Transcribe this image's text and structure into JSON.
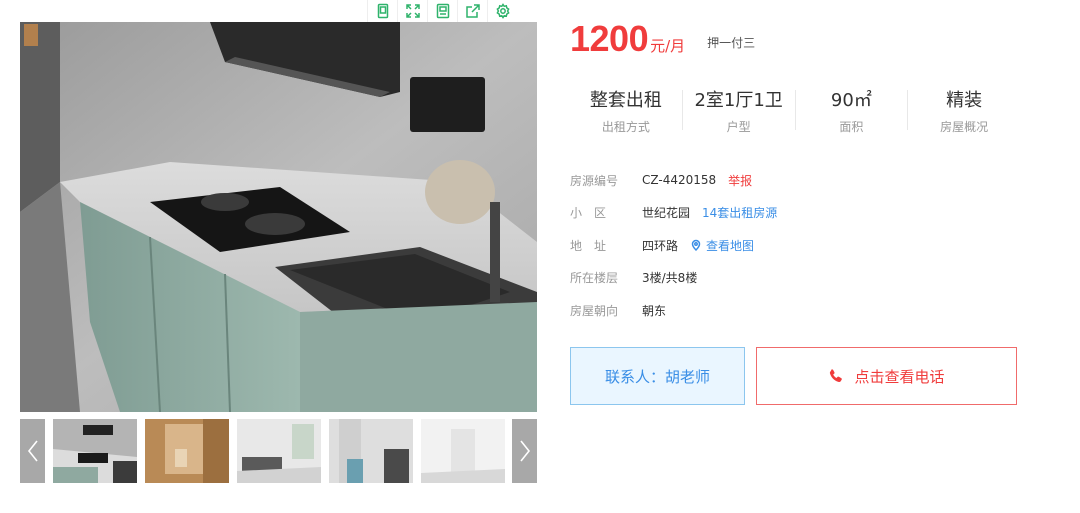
{
  "toolbar": {
    "icons": [
      "tablet-icon",
      "fullscreen-icon",
      "save-icon",
      "share-icon",
      "settings-icon"
    ]
  },
  "gallery": {
    "prev_icon": "chevron-left-icon",
    "next_icon": "chevron-right-icon",
    "thumbnails": [
      "kitchen",
      "bathroom",
      "living-room",
      "bedroom",
      "hallway"
    ]
  },
  "price": {
    "amount": "1200",
    "unit": "元/月",
    "payment_terms": "押一付三"
  },
  "attributes": [
    {
      "value": "整套出租",
      "label": "出租方式"
    },
    {
      "value": "2室1厅1卫",
      "label": "户型"
    },
    {
      "value": "90㎡",
      "label": "面积"
    },
    {
      "value": "精装",
      "label": "房屋概况"
    }
  ],
  "details": {
    "listing_id": {
      "label": "房源编号",
      "value": "CZ-4420158",
      "action": "举报"
    },
    "community": {
      "label": "小　区",
      "value": "世纪花园",
      "action": "14套出租房源"
    },
    "address": {
      "label": "地　址",
      "value": "四环路",
      "action": "查看地图"
    },
    "floor": {
      "label": "所在楼层",
      "value": "3楼/共8楼"
    },
    "orientation": {
      "label": "房屋朝向",
      "value": "朝东"
    }
  },
  "contact": {
    "label": "联系人：胡老师"
  },
  "phone": {
    "label": "点击查看电话"
  },
  "colors": {
    "price_red": "#f03c3c",
    "link_blue": "#3a8ee6",
    "toolbar_green": "#2fb36b"
  }
}
